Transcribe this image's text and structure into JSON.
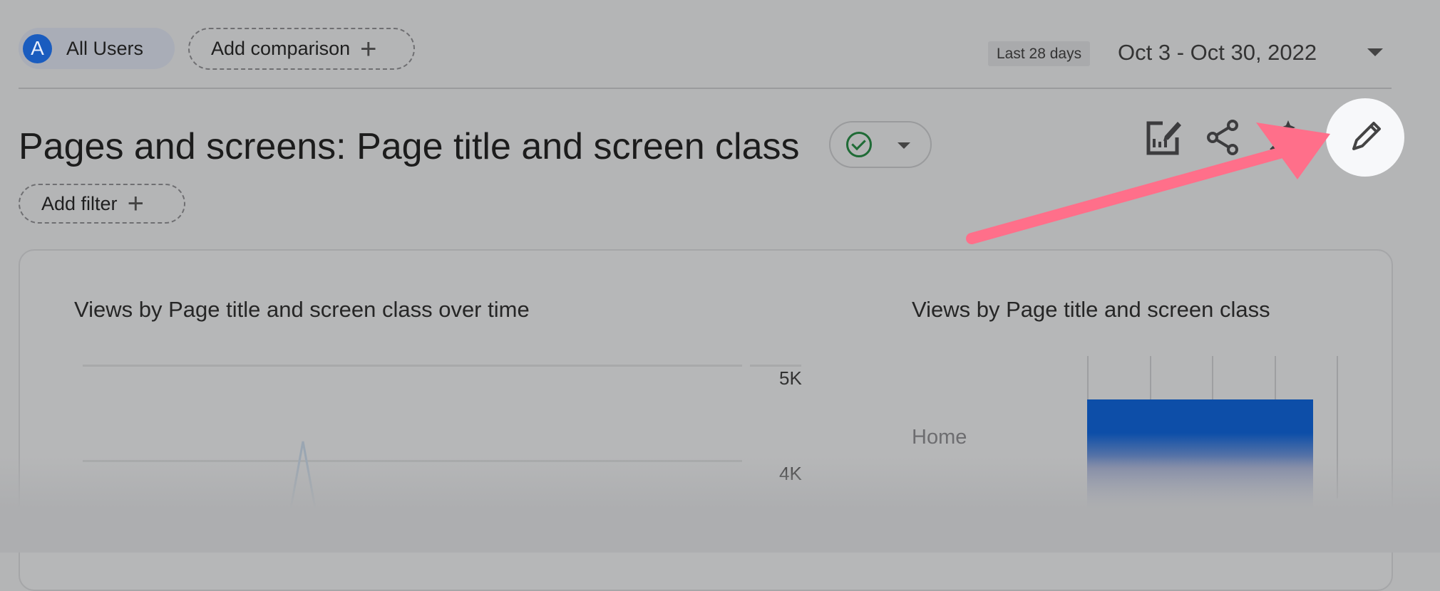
{
  "header": {
    "segment": {
      "avatar_letter": "A",
      "label": "All Users"
    },
    "add_comparison_label": "Add comparison",
    "date_range_label": "Last 28 days",
    "date_range_value": "Oct 3 - Oct 30, 2022"
  },
  "report": {
    "title": "Pages and screens: Page title and screen class",
    "add_filter_label": "Add filter",
    "toolbar_icons": [
      "customize-report-icon",
      "share-icon",
      "insights-icon",
      "edit-pencil-icon"
    ]
  },
  "colors": {
    "bar": "#0d4ea8",
    "annotation_arrow": "#ff6f8a",
    "status_check": "#1f6b36"
  },
  "chart_data": [
    {
      "type": "line",
      "title": "Views by Page title and screen class over time",
      "y_ticks": [
        "5K",
        "4K"
      ],
      "grid": true
    },
    {
      "type": "bar",
      "orientation": "horizontal",
      "title": "Views by Page title and screen class",
      "categories": [
        "Home"
      ],
      "grid": true
    }
  ]
}
